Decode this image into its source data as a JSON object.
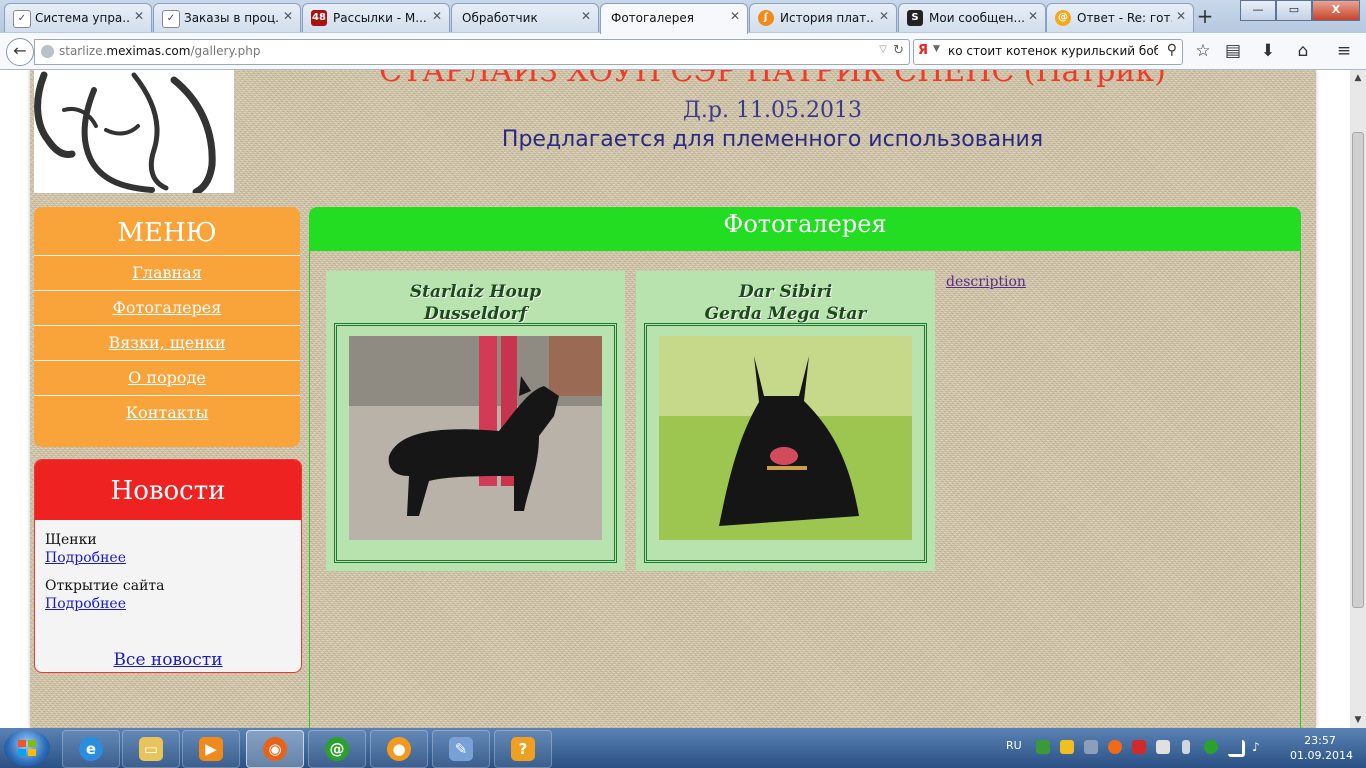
{
  "browser": {
    "tabs": [
      {
        "label": "Система упра...",
        "favicon": "mail-icon",
        "active": false
      },
      {
        "label": "Заказы в проц...",
        "favicon": "mail-icon",
        "active": false
      },
      {
        "label": "Рассылки - М...",
        "favicon": "48",
        "active": false
      },
      {
        "label": "Обработчик",
        "favicon": "",
        "active": false
      },
      {
        "label": "Фотогалерея",
        "favicon": "",
        "active": true
      },
      {
        "label": "История плат...",
        "favicon": "flame-icon",
        "active": false
      },
      {
        "label": "Мои сообщен...",
        "favicon": "S",
        "active": false
      },
      {
        "label": "Ответ - Re: гот...",
        "favicon": "at-icon",
        "active": false
      }
    ],
    "new_tab": "+",
    "window_controls": {
      "minimize": "—",
      "maximize": "▭",
      "close": "X"
    },
    "url": {
      "prefix": "starlize.",
      "domain": "meximas.com",
      "path": "/gallery.php"
    },
    "search": {
      "engine": "Я",
      "query": "ко стоит котенок курильский бобтейл"
    }
  },
  "page": {
    "headline": "СТАРЛАЙЗ ХОУП СЭР ПАТРИК СПЕНС (Патрик)",
    "dob": "Д.р. 11.05.2013",
    "offer": "Предлагается для племенного использования",
    "menu": {
      "title": "МЕНЮ",
      "items": [
        "Главная",
        "Фотогалерея",
        "Вязки, щенки",
        "О породе",
        "Контакты"
      ]
    },
    "news": {
      "title": "Новости",
      "items": [
        {
          "title": "Щенки",
          "link": "Подробнее"
        },
        {
          "title": "Открытие сайта",
          "link": "Подробнее"
        }
      ],
      "all": "Все новости"
    },
    "gallery": {
      "title": "Фотогалерея",
      "photos": [
        {
          "line1": "Starlaiz Houp",
          "line2": "Dusseldorf"
        },
        {
          "line1": "Dar Sibiri",
          "line2": "Gerda Mega Star"
        }
      ],
      "description_link": "description"
    }
  },
  "taskbar": {
    "lang": "RU",
    "time": "23:57",
    "date": "01.09.2014"
  },
  "colors": {
    "menu": "#f9a43a",
    "news_header": "#ef2222",
    "gallery_header": "#22dd22",
    "headline": "#ee3b2a"
  }
}
